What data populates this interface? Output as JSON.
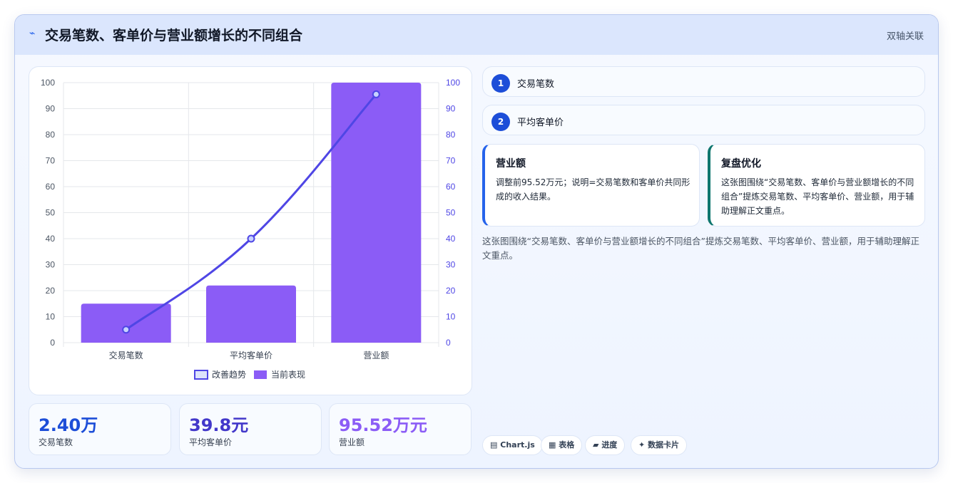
{
  "header": {
    "icon": "trend-line-icon",
    "title": "交易笔数、客单价与营业额增长的不同组合",
    "tag": "双轴关联"
  },
  "chart_data": {
    "type": "bar",
    "categories": [
      "交易笔数",
      "平均客单价",
      "营业额"
    ],
    "series": [
      {
        "name": "改善趋势",
        "type": "line",
        "axis": "right",
        "values": [
          5,
          40,
          95.5
        ],
        "color": "#4f46e5"
      },
      {
        "name": "当前表现",
        "type": "bar",
        "axis": "left",
        "values": [
          15,
          22,
          100
        ],
        "color": "#8b5cf6"
      }
    ],
    "ylim": [
      0,
      100
    ],
    "y2lim": [
      0,
      100
    ],
    "yticks": [
      0,
      10,
      20,
      30,
      40,
      50,
      60,
      70,
      80,
      90,
      100
    ],
    "grid": true,
    "legend_position": "bottom"
  },
  "kpis": [
    {
      "value": "2.40万",
      "label": "交易笔数",
      "color": "#1d4ed8"
    },
    {
      "value": "39.8元",
      "label": "平均客单价",
      "color": "#4338ca"
    },
    {
      "value": "95.52万元",
      "label": "营业额",
      "color": "#8b5cf6"
    }
  ],
  "steps": [
    {
      "num": "1",
      "label": "交易笔数"
    },
    {
      "num": "2",
      "label": "平均客单价"
    }
  ],
  "cards": [
    {
      "title": "营业额",
      "body": "调整前95.52万元；说明=交易笔数和客单价共同形成的收入结果。",
      "accent": "#2563eb"
    },
    {
      "title": "复盘优化",
      "body": "这张图围绕“交易笔数、客单价与营业额增长的不同组合”提炼交易笔数、平均客单价、营业额，用于辅助理解正文重点。",
      "accent": "#0f766e"
    }
  ],
  "summary": "这张图围绕“交易笔数、客单价与营业额增长的不同组合”提炼交易笔数、平均客单价、营业额，用于辅助理解正文重点。",
  "chips": [
    {
      "icon": "chart-icon",
      "glyph": "▤",
      "label": "Chart.js"
    },
    {
      "icon": "table-icon",
      "glyph": "▦",
      "label": "表格"
    },
    {
      "icon": "progress-icon",
      "glyph": "▰",
      "label": "进度"
    },
    {
      "icon": "sparkle-icon",
      "glyph": "✦",
      "label": "数据卡片"
    }
  ]
}
